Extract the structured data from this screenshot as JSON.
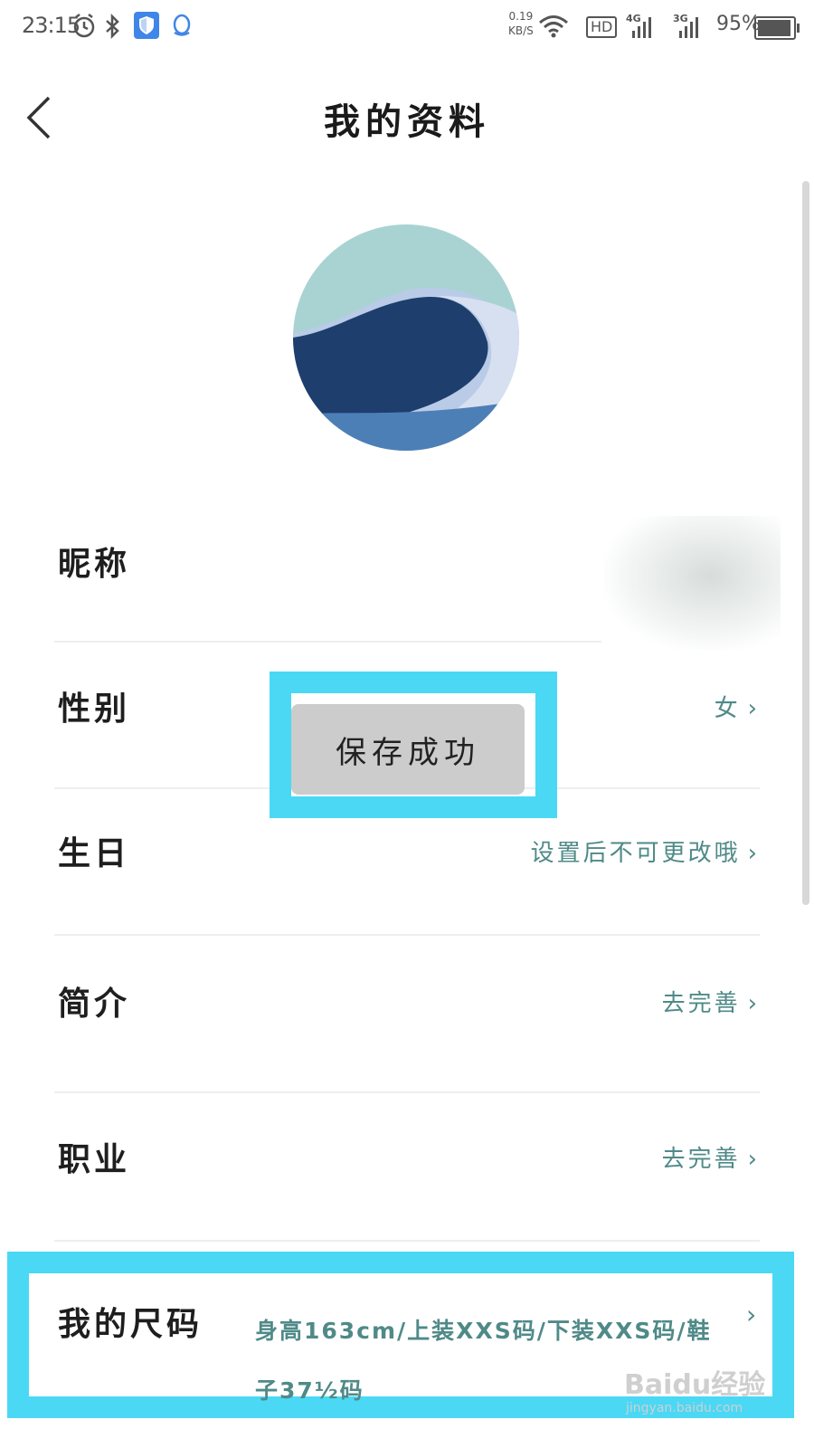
{
  "status_bar": {
    "time": "23:15",
    "net_speed_value": "0.19",
    "net_speed_unit": "KB/S",
    "hd_label": "HD",
    "net1_label": "4G",
    "net2_label": "3G",
    "battery": "95%",
    "icons": [
      "alarm-icon",
      "bluetooth-icon",
      "shield-icon",
      "qq-icon",
      "wifi-icon",
      "signal-icon",
      "battery-icon"
    ]
  },
  "header": {
    "title": "我的资料",
    "back_icon": "back-arrow-icon"
  },
  "profile": {
    "rows": [
      {
        "label": "昵称",
        "value": ""
      },
      {
        "label": "性别",
        "value": "女"
      },
      {
        "label": "生日",
        "value": "设置后不可更改哦"
      },
      {
        "label": "简介",
        "value": "去完善"
      },
      {
        "label": "职业",
        "value": "去完善"
      },
      {
        "label": "我的尺码",
        "value": "身高163cm/上装XXS码/下装XXS码/鞋子37½码"
      }
    ],
    "chevron": "›"
  },
  "toast": {
    "message": "保存成功"
  },
  "watermark": {
    "brand": "Baidu经验",
    "url": "jingyan.baidu.com"
  },
  "colors": {
    "accent_value": "#4f8a88",
    "highlight": "#4ad8f5",
    "toast_bg": "#cccccc"
  }
}
